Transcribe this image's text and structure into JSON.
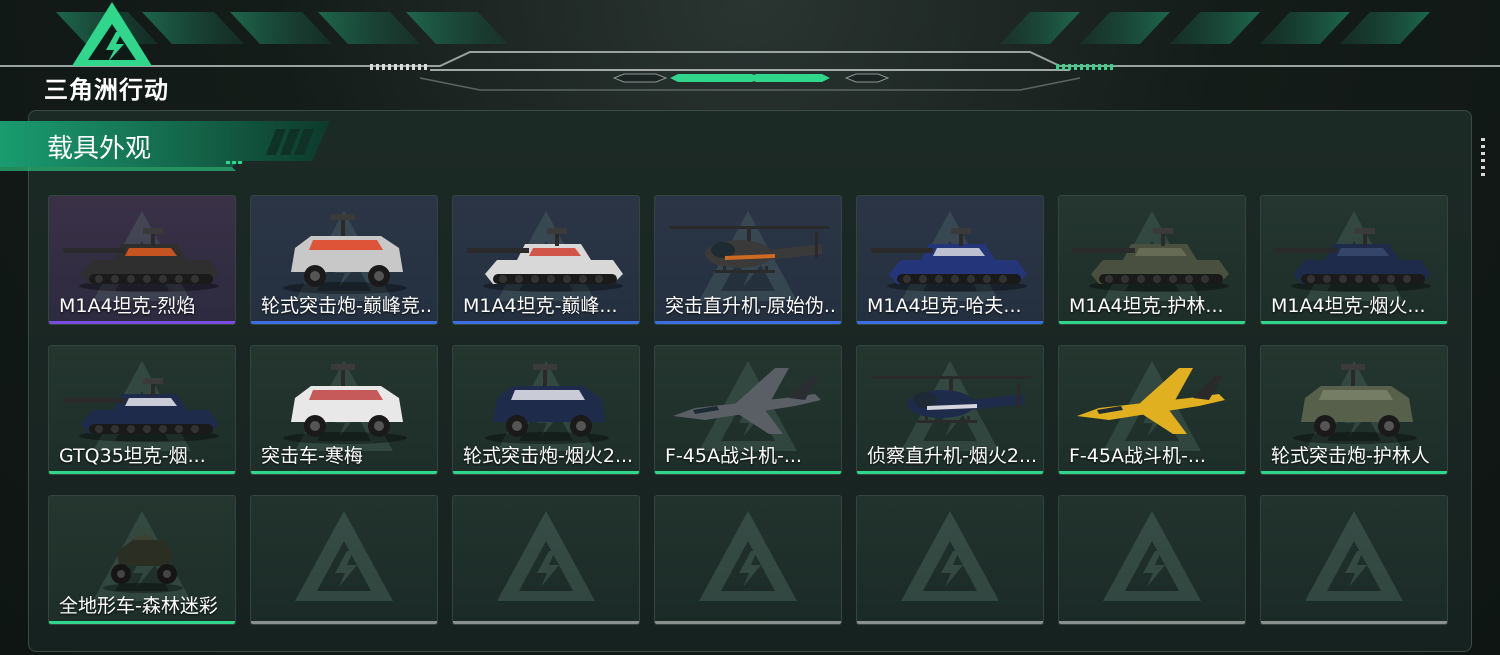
{
  "app": {
    "logo_text": "三角洲行动"
  },
  "section": {
    "title": "载具外观"
  },
  "colors": {
    "accent_green": "#2fd68c",
    "rarity_purple": "#7a4be0",
    "rarity_blue": "#3b6fe0",
    "empty_gray": "#8a908e"
  },
  "skins": [
    {
      "label": "M1A4坦克-烈焰",
      "rarity": "purple",
      "icon": "tank-flame-icon"
    },
    {
      "label": "轮式突击炮-巅峰竞...",
      "rarity": "blue",
      "icon": "wheeled-assault-gun-icon"
    },
    {
      "label": "M1A4坦克-巅峰...",
      "rarity": "blue",
      "icon": "tank-peak-icon"
    },
    {
      "label": "突击直升机-原始伪...",
      "rarity": "blue",
      "icon": "attack-helicopter-icon"
    },
    {
      "label": "M1A4坦克-哈夫...",
      "rarity": "blue",
      "icon": "tank-blue-icon"
    },
    {
      "label": "M1A4坦克-护林...",
      "rarity": "green",
      "icon": "tank-camo-icon"
    },
    {
      "label": "M1A4坦克-烟火...",
      "rarity": "green",
      "icon": "tank-fireworks-icon"
    },
    {
      "label": "GTQ35坦克-烟...",
      "rarity": "green",
      "icon": "tank-gtq35-icon"
    },
    {
      "label": "突击车-寒梅",
      "rarity": "green",
      "icon": "assault-vehicle-icon"
    },
    {
      "label": "轮式突击炮-烟火2...",
      "rarity": "green",
      "icon": "wheeled-assault-gun-2025-icon"
    },
    {
      "label": "F-45A战斗机-...",
      "rarity": "green",
      "icon": "fighter-jet-camo-icon"
    },
    {
      "label": "侦察直升机-烟火2...",
      "rarity": "green",
      "icon": "scout-helicopter-icon"
    },
    {
      "label": "F-45A战斗机-...",
      "rarity": "green",
      "icon": "fighter-jet-yellow-icon"
    },
    {
      "label": "轮式突击炮-护林人",
      "rarity": "green",
      "icon": "wheeled-assault-gun-camo-icon"
    },
    {
      "label": "全地形车-森林迷彩",
      "rarity": "green",
      "icon": "atv-icon"
    }
  ],
  "empty_slots": 6
}
